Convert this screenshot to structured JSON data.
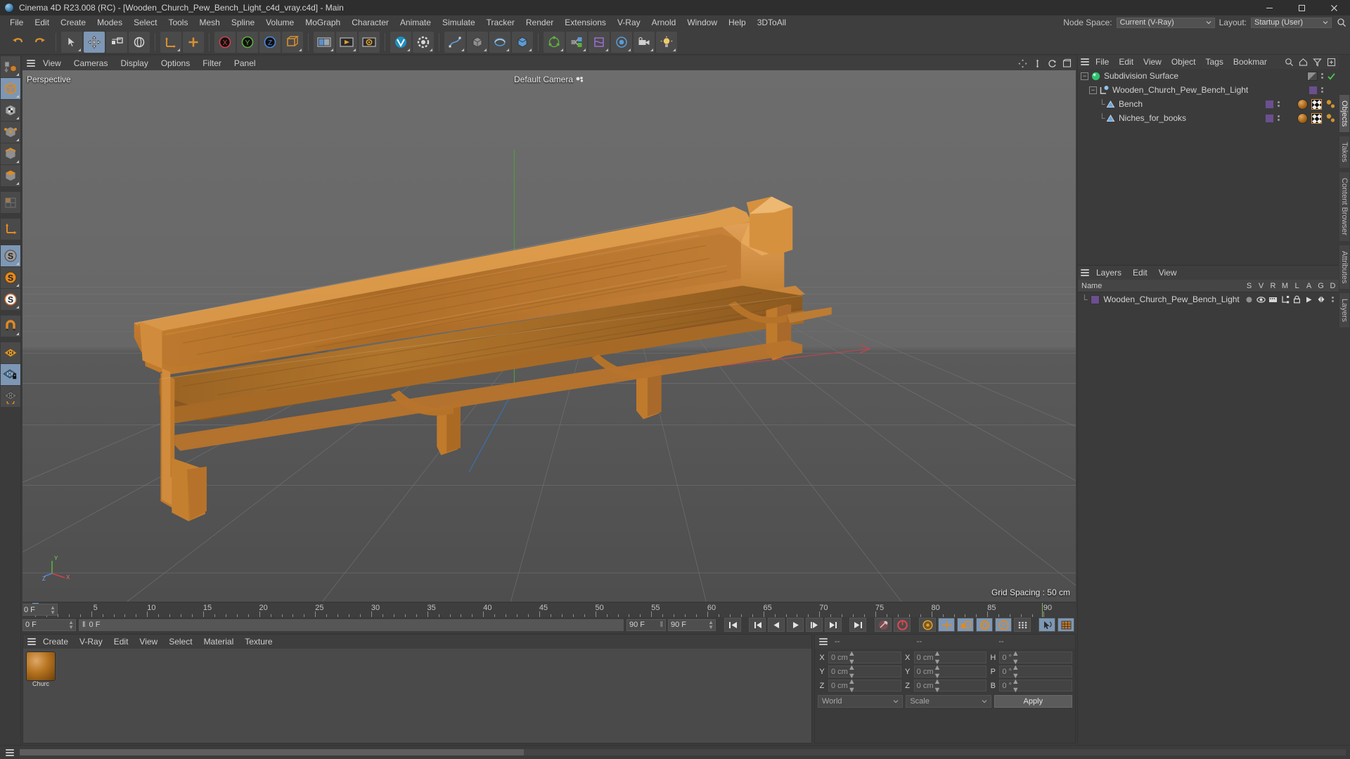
{
  "window": {
    "title": "Cinema 4D R23.008 (RC) - [Wooden_Church_Pew_Bench_Light_c4d_vray.c4d] - Main",
    "minimize": "–",
    "maximize": "☐",
    "close": "✕"
  },
  "menubar": {
    "items": [
      "File",
      "Edit",
      "Create",
      "Modes",
      "Select",
      "Tools",
      "Mesh",
      "Spline",
      "Volume",
      "MoGraph",
      "Character",
      "Animate",
      "Simulate",
      "Tracker",
      "Render",
      "Extensions",
      "V-Ray",
      "Arnold",
      "Window",
      "Help",
      "3DToAll"
    ],
    "node_space_label": "Node Space:",
    "node_space_value": "Current (V-Ray)",
    "layout_label": "Layout:",
    "layout_value": "Startup (User)",
    "search_icon": "search-icon"
  },
  "toolbar": {
    "groups": [
      {
        "buttons": [
          {
            "name": "undo-button",
            "icon": "undo",
            "state": "off"
          },
          {
            "name": "redo-button",
            "icon": "redo",
            "state": "off"
          }
        ]
      },
      {
        "buttons": [
          {
            "name": "live-selection-button",
            "icon": "cursor-select",
            "state": "off"
          },
          {
            "name": "move-button",
            "icon": "move",
            "state": "on"
          },
          {
            "name": "scale-button",
            "icon": "scale",
            "state": "off"
          },
          {
            "name": "rotate-button",
            "icon": "rotate",
            "state": "off"
          }
        ]
      },
      {
        "buttons": [
          {
            "name": "world-object-axis-button",
            "icon": "axis-world",
            "state": "off"
          },
          {
            "name": "add-cube-button",
            "icon": "plus",
            "state": "off"
          }
        ]
      },
      {
        "buttons": [
          {
            "name": "x-axis-lock-button",
            "icon": "x-lock",
            "state": "off"
          },
          {
            "name": "y-axis-lock-button",
            "icon": "y-lock",
            "state": "off"
          },
          {
            "name": "z-axis-lock-button",
            "icon": "z-lock",
            "state": "off"
          },
          {
            "name": "axis-system-button",
            "icon": "axis-system",
            "state": "off"
          }
        ]
      },
      {
        "buttons": [
          {
            "name": "render-view-button",
            "icon": "render-view",
            "state": "off"
          },
          {
            "name": "render-to-picture-viewer-button",
            "icon": "render-picture",
            "state": "off"
          },
          {
            "name": "render-settings-button",
            "icon": "render-settings",
            "state": "off"
          }
        ]
      },
      {
        "buttons": [
          {
            "name": "vray-render-button",
            "icon": "vray",
            "state": "off"
          },
          {
            "name": "vray-settings-button",
            "icon": "vray-gear",
            "state": "off"
          }
        ]
      },
      {
        "buttons": [
          {
            "name": "spline-pen-button",
            "icon": "pen",
            "state": "off"
          },
          {
            "name": "primitive-cube-button",
            "icon": "cube",
            "state": "off"
          },
          {
            "name": "nurbs-button",
            "icon": "nurbs",
            "state": "off"
          },
          {
            "name": "modeling-object-button",
            "icon": "modeling",
            "state": "off"
          }
        ]
      },
      {
        "buttons": [
          {
            "name": "array-button",
            "icon": "array",
            "state": "off"
          },
          {
            "name": "scene-nodes-button",
            "icon": "scene",
            "state": "off"
          },
          {
            "name": "deformer-button",
            "icon": "deformer",
            "state": "off"
          },
          {
            "name": "field-button",
            "icon": "field",
            "state": "off"
          },
          {
            "name": "camera-button",
            "icon": "camera",
            "state": "off"
          },
          {
            "name": "light-button",
            "icon": "light",
            "state": "off"
          }
        ]
      }
    ]
  },
  "left_toolbar": {
    "items": [
      {
        "name": "make-editable-tool",
        "icon": "make-editable",
        "state": "off"
      },
      {
        "name": "model-mode-tool",
        "icon": "model-cube",
        "state": "on"
      },
      {
        "name": "texture-mode-tool",
        "icon": "texture-cube",
        "state": "off"
      },
      {
        "name": "points-mode-tool",
        "icon": "points-cube",
        "state": "off"
      },
      {
        "name": "edges-mode-tool",
        "icon": "edges-cube",
        "state": "off"
      },
      {
        "name": "polygons-mode-tool",
        "icon": "polygons-cube",
        "state": "off"
      },
      {
        "name": "uv-mode-tool",
        "icon": "uv-grid",
        "state": "off"
      },
      {
        "name": "axis-modify-tool",
        "icon": "axis-corner",
        "state": "off"
      },
      {
        "name": "enable-axis-tool",
        "icon": "s-grey",
        "state": "on"
      },
      {
        "name": "viewport-solo-single-tool",
        "icon": "s-orange",
        "state": "off"
      },
      {
        "name": "viewport-solo-hierarchy-tool",
        "icon": "s-white",
        "state": "off"
      },
      {
        "name": "snap-tool",
        "icon": "magnet",
        "state": "off"
      },
      {
        "name": "workplane-tool",
        "icon": "workplane",
        "state": "off"
      },
      {
        "name": "lock-workplane-tool",
        "icon": "workplane-lock",
        "state": "on"
      },
      {
        "name": "planar-workplane-tool",
        "icon": "workplane-rotate",
        "state": "off"
      }
    ]
  },
  "viewport": {
    "menu": [
      "View",
      "Cameras",
      "Display",
      "Options",
      "Filter",
      "Panel"
    ],
    "label_perspective": "Perspective",
    "label_camera": "Default Camera",
    "label_grid_spacing": "Grid Spacing : 50 cm",
    "axis_x": "X",
    "axis_y": "Y",
    "axis_z": "Z",
    "icons": [
      "move-view-icon",
      "scale-view-icon",
      "rotate-view-icon",
      "maximize-view-icon"
    ]
  },
  "timeline": {
    "ticks": [
      0,
      5,
      10,
      15,
      20,
      25,
      30,
      35,
      40,
      45,
      50,
      55,
      60,
      65,
      70,
      75,
      80,
      85,
      90
    ],
    "range_start": 0,
    "range_end": 90,
    "current_frame_field": "0 F",
    "current_frame_bar": "0 F",
    "end_frame_static": "90 F",
    "end_frame_field": "90 F",
    "preview_end_field": "0 F",
    "transport": [
      {
        "name": "go-to-start-button",
        "icon": "skip-start"
      },
      {
        "name": "go-to-previous-keyframe-button",
        "icon": "prev-key"
      },
      {
        "name": "step-back-button",
        "icon": "step-back"
      },
      {
        "name": "play-button",
        "icon": "play"
      },
      {
        "name": "step-forward-button",
        "icon": "step-forward"
      },
      {
        "name": "go-to-next-keyframe-button",
        "icon": "next-key"
      },
      {
        "name": "go-to-end-button",
        "icon": "skip-end"
      }
    ],
    "record_tools": [
      {
        "name": "record-active-objects-button",
        "icon": "record-key",
        "state": "off"
      },
      {
        "name": "autokeying-button",
        "icon": "autokey",
        "state": "off"
      }
    ],
    "key_tools": [
      {
        "name": "keyframe-selection-button",
        "icon": "key-gear",
        "state": "off"
      },
      {
        "name": "position-key-button",
        "icon": "key-position",
        "state": "on"
      },
      {
        "name": "scale-key-button",
        "icon": "key-scale",
        "state": "on"
      },
      {
        "name": "rotation-key-button",
        "icon": "key-rotation",
        "state": "on"
      },
      {
        "name": "parameter-key-button",
        "icon": "key-parameter",
        "state": "on"
      },
      {
        "name": "point-level-animation-button",
        "icon": "key-pla",
        "state": "off"
      }
    ],
    "extra_tools": [
      {
        "name": "select-mode-button",
        "icon": "cursor-wave",
        "state": "on"
      },
      {
        "name": "timeline-view-button",
        "icon": "timeline-grid",
        "state": "on"
      }
    ]
  },
  "material_manager": {
    "menu": [
      "Create",
      "V-Ray",
      "Edit",
      "View",
      "Select",
      "Material",
      "Texture"
    ],
    "materials": [
      {
        "name": "Church",
        "label": "Churc"
      }
    ]
  },
  "coordinates": {
    "header": [
      "--",
      "--",
      "--"
    ],
    "rows": [
      {
        "axis1": "X",
        "v1": "0 cm",
        "axis2": "X",
        "v2": "0 cm",
        "axis3": "H",
        "v3": "0 °"
      },
      {
        "axis1": "Y",
        "v1": "0 cm",
        "axis2": "Y",
        "v2": "0 cm",
        "axis3": "P",
        "v3": "0 °"
      },
      {
        "axis1": "Z",
        "v1": "0 cm",
        "axis2": "Z",
        "v2": "0 cm",
        "axis3": "B",
        "v3": "0 °"
      }
    ],
    "world_select": "World",
    "scale_select": "Scale",
    "apply_button": "Apply"
  },
  "object_manager": {
    "menu": [
      "File",
      "Edit",
      "View",
      "Object",
      "Tags",
      "Bookmar"
    ],
    "icons": [
      "search-icon",
      "home-icon",
      "filter-icon",
      "add-icon"
    ],
    "items": [
      {
        "name": "Subdivision Surface",
        "depth": 0,
        "icon": "subdivision-surface-icon",
        "expandable": true,
        "checkmark": true,
        "display_tag": true,
        "tag_square": false
      },
      {
        "name": "Wooden_Church_Pew_Bench_Light",
        "depth": 1,
        "icon": "null-object-icon",
        "expandable": true,
        "checkmark": false,
        "display_tag": false,
        "tag_square": true
      },
      {
        "name": "Bench",
        "depth": 2,
        "icon": "polygon-object-icon",
        "expandable": false,
        "checkmark": false,
        "display_tag": false,
        "tag_square": true,
        "tags": [
          "material",
          "uv",
          "selection"
        ]
      },
      {
        "name": "Niches_for_books",
        "depth": 2,
        "icon": "polygon-object-icon",
        "expandable": false,
        "checkmark": false,
        "display_tag": false,
        "tag_square": true,
        "tags": [
          "material",
          "uv",
          "selection"
        ]
      }
    ]
  },
  "right_tabs": [
    "Objects",
    "Takes",
    "Content Browser",
    "Attributes",
    "Layers"
  ],
  "layers_manager": {
    "menu": [
      "Layers",
      "Edit",
      "View"
    ],
    "name_header": "Name",
    "columns": [
      "S",
      "V",
      "R",
      "M",
      "L",
      "A",
      "G",
      "D"
    ],
    "rows": [
      {
        "name": "Wooden_Church_Pew_Bench_Light",
        "color": "#6b4f8f"
      }
    ]
  }
}
